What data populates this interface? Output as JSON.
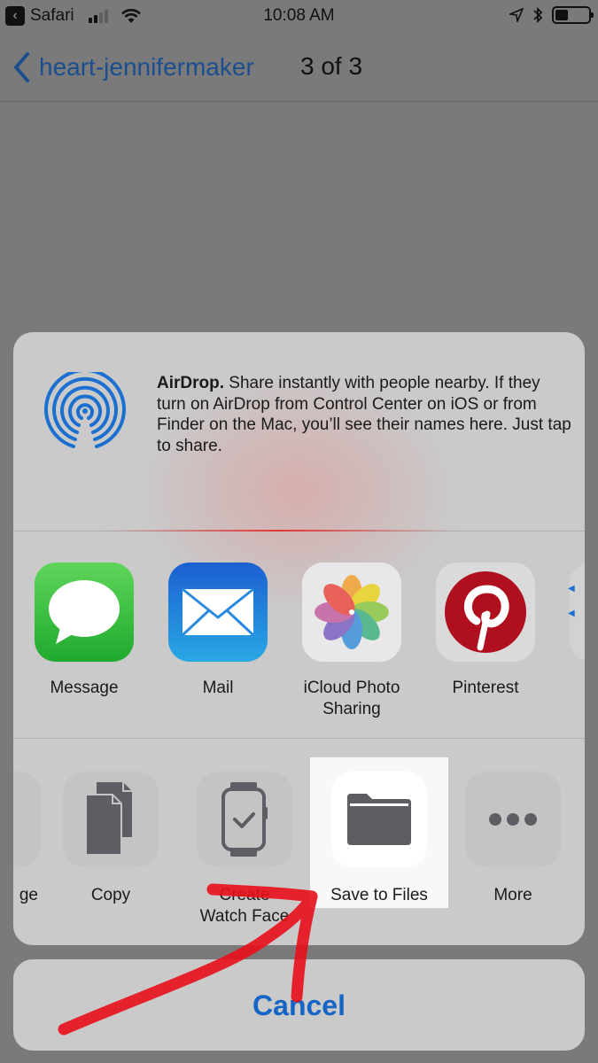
{
  "status_bar": {
    "back_app": "Safari",
    "time": "10:08 AM",
    "signal_bars_active": 2,
    "signal_bars_total": 4,
    "battery_level": 0.4,
    "icons": [
      "back-to-app-icon",
      "signal-icon",
      "wifi-icon",
      "location-icon",
      "bluetooth-icon",
      "battery-icon"
    ]
  },
  "nav": {
    "back_label": "heart-jennifermaker",
    "title": "3 of 3"
  },
  "share_sheet": {
    "airdrop": {
      "title": "AirDrop.",
      "description": " Share instantly with people nearby. If they turn on AirDrop from Control Center on iOS or from Finder on the Mac, you’ll see their names here. Just tap to share."
    },
    "apps": [
      {
        "label": "Message",
        "icon": "message-icon"
      },
      {
        "label": "Mail",
        "icon": "mail-icon"
      },
      {
        "label": "iCloud Photo\nSharing",
        "icon": "photos-icon"
      },
      {
        "label": "Pinterest",
        "icon": "pinterest-icon"
      }
    ],
    "actions": [
      {
        "label": "ge",
        "icon": "partial-action-icon"
      },
      {
        "label": "Copy",
        "icon": "copy-icon"
      },
      {
        "label": "Create\nWatch Face",
        "icon": "watch-icon"
      },
      {
        "label": "Save to Files",
        "icon": "folder-icon",
        "highlighted": true
      },
      {
        "label": "More",
        "icon": "more-icon"
      }
    ]
  },
  "cancel": {
    "label": "Cancel"
  },
  "colors": {
    "accent": "#1565c6",
    "nav_link": "#1b4d8f",
    "annotation": "#e8101a"
  }
}
